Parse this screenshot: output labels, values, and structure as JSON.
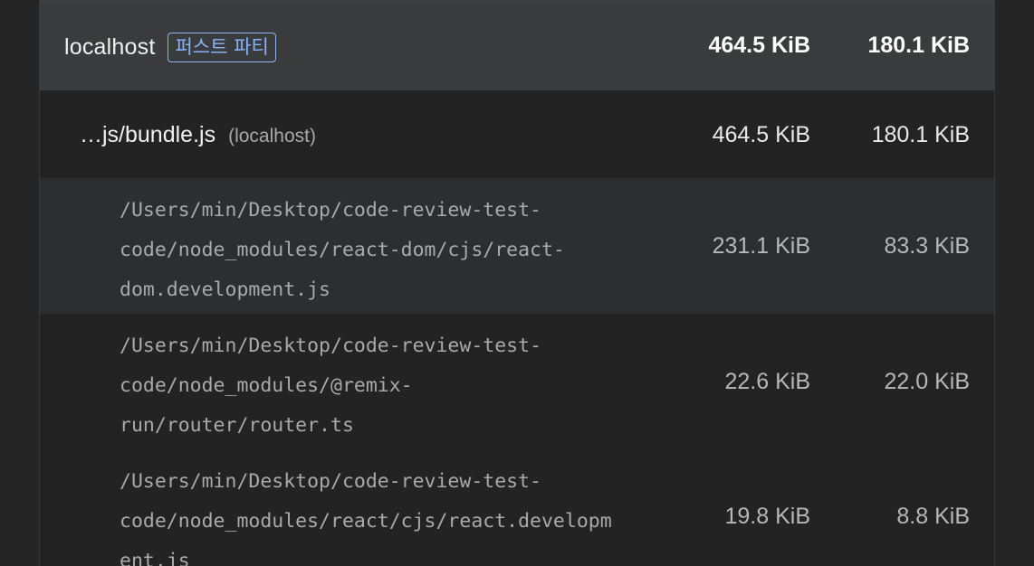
{
  "group": {
    "host": "localhost",
    "badge": "퍼스트 파티",
    "transfer_size": "464.5 KiB",
    "resource_size": "180.1 KiB"
  },
  "bundle": {
    "file": "…js/bundle.js",
    "host": "(localhost)",
    "transfer_size": "464.5 KiB",
    "resource_size": "180.1 KiB"
  },
  "files": [
    {
      "path_lines": [
        "/Users/min/Desktop/code-review-test-",
        "code/node_modules/react-dom/cjs/react-",
        "dom.development.js"
      ],
      "transfer_size": "231.1 KiB",
      "resource_size": "83.3 KiB"
    },
    {
      "path_lines": [
        "/Users/min/Desktop/code-review-test-",
        "code/node_modules/@remix-",
        "run/router/router.ts"
      ],
      "transfer_size": "22.6 KiB",
      "resource_size": "22.0 KiB"
    },
    {
      "path_lines": [
        "/Users/min/Desktop/code-review-test-",
        "code/node_modules/react/cjs/react.developm",
        "ent.js"
      ],
      "transfer_size": "19.8 KiB",
      "resource_size": "8.8 KiB"
    }
  ]
}
